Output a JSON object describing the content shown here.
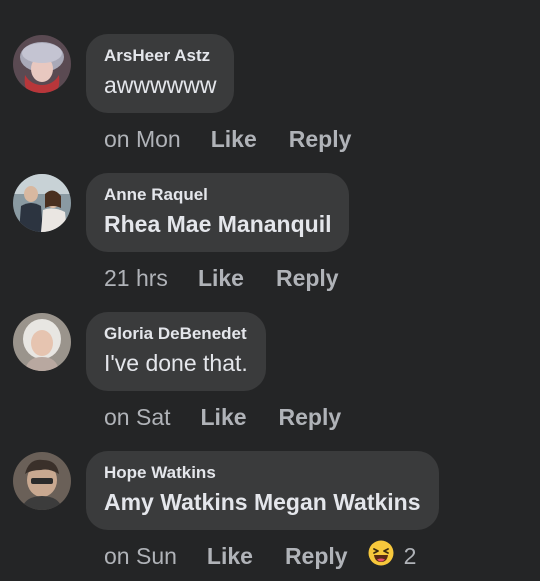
{
  "comments": [
    {
      "author": "ArsHeer Astz",
      "text": "awwwwww",
      "time": "on Mon",
      "like_label": "Like",
      "reply_label": "Reply"
    },
    {
      "author": "Anne Raquel",
      "text": "Rhea Mae Mananquil",
      "time": "21 hrs",
      "like_label": "Like",
      "reply_label": "Reply"
    },
    {
      "author": "Gloria DeBenedet",
      "text": "I've done that.",
      "time": "on Sat",
      "like_label": "Like",
      "reply_label": "Reply"
    },
    {
      "author": "Hope Watkins",
      "text": "Amy Watkins Megan Watkins",
      "time": "on Sun",
      "like_label": "Like",
      "reply_label": "Reply",
      "reaction": {
        "icon": "haha-emoji-icon",
        "count": "2"
      }
    }
  ],
  "colors": {
    "background": "#242526",
    "bubble": "#3a3b3c",
    "primary_text": "#e4e6eb",
    "secondary_text": "#b0b3b8",
    "haha_yellow": "#f7c83c"
  }
}
